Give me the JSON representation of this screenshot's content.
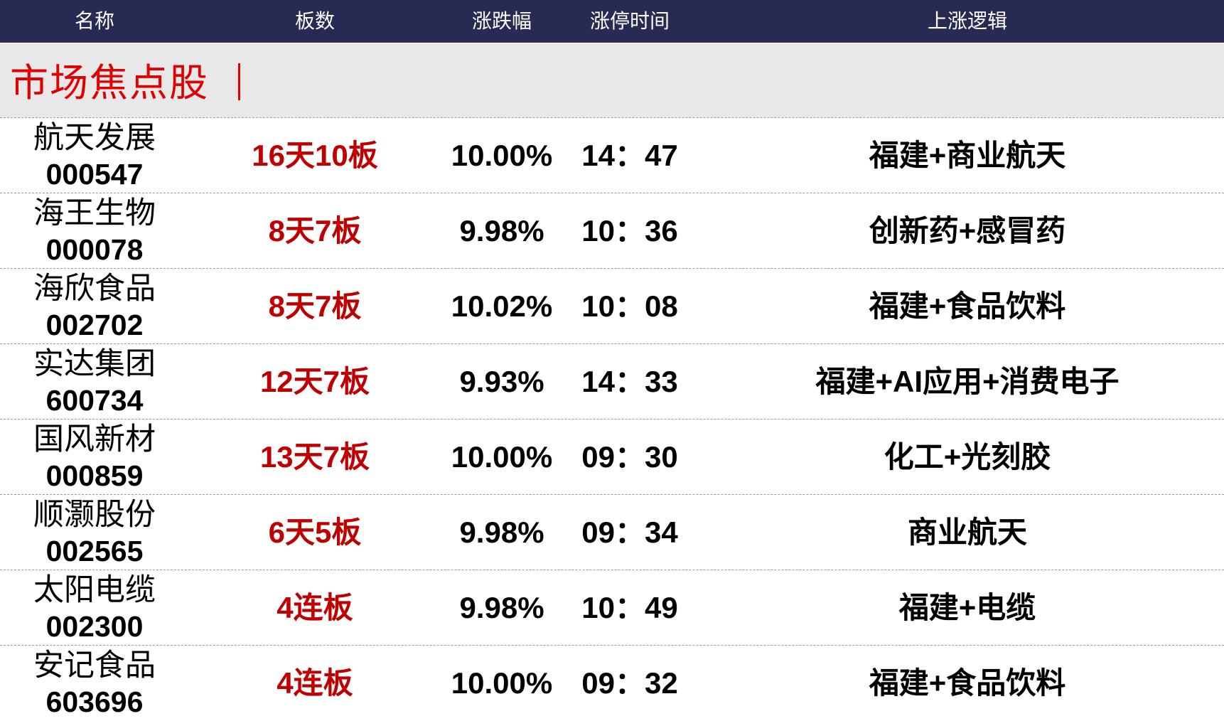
{
  "header": {
    "name": "名称",
    "boards": "板数",
    "change": "涨跌幅",
    "limit_time": "涨停时间",
    "logic": "上涨逻辑"
  },
  "section": {
    "title": "市场焦点股"
  },
  "rows": [
    {
      "name": "航天发展",
      "code": "000547",
      "boards": "16天10板",
      "change": "10.00%",
      "time": "14：47",
      "logic": "福建+商业航天"
    },
    {
      "name": "海王生物",
      "code": "000078",
      "boards": "8天7板",
      "change": "9.98%",
      "time": "10：36",
      "logic": "创新药+感冒药"
    },
    {
      "name": "海欣食品",
      "code": "002702",
      "boards": "8天7板",
      "change": "10.02%",
      "time": "10：08",
      "logic": "福建+食品饮料"
    },
    {
      "name": "实达集团",
      "code": "600734",
      "boards": "12天7板",
      "change": "9.93%",
      "time": "14：33",
      "logic": "福建+AI应用+消费电子"
    },
    {
      "name": "国风新材",
      "code": "000859",
      "boards": "13天7板",
      "change": "10.00%",
      "time": "09：30",
      "logic": "化工+光刻胶"
    },
    {
      "name": "顺灏股份",
      "code": "002565",
      "boards": "6天5板",
      "change": "9.98%",
      "time": "09：34",
      "logic": "商业航天"
    },
    {
      "name": "太阳电缆",
      "code": "002300",
      "boards": "4连板",
      "change": "9.98%",
      "time": "10：49",
      "logic": "福建+电缆"
    },
    {
      "name": "安记食品",
      "code": "603696",
      "boards": "4连板",
      "change": "10.00%",
      "time": "09：32",
      "logic": "福建+食品饮料"
    }
  ]
}
